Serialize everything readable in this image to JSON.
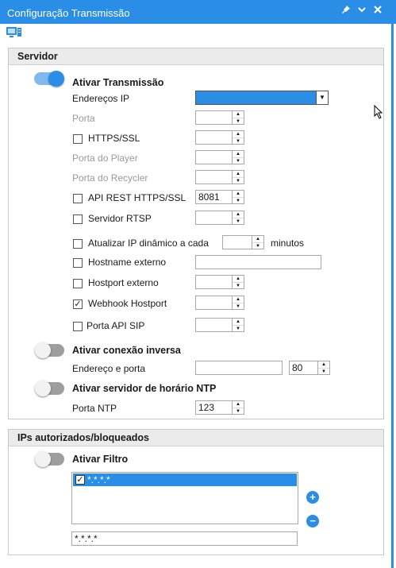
{
  "window": {
    "title": "Configuração Transmissão"
  },
  "servidor": {
    "header": "Servidor",
    "ativar_transmissao": "Ativar Transmissão",
    "enderecos_ip": "Endereços IP",
    "porta": "Porta",
    "https_ssl": "HTTPS/SSL",
    "porta_player": "Porta do Player",
    "porta_recycler": "Porta do Recycler",
    "api_rest": "API REST HTTPS/SSL",
    "api_rest_value": "8081",
    "rtsp": "Servidor RTSP",
    "atualizar_ip": "Atualizar IP dinâmico a cada",
    "minutos": "minutos",
    "hostname": "Hostname externo",
    "hostport": "Hostport externo",
    "webhook": "Webhook Hostport",
    "porta_api_sip": "Porta API SIP",
    "conexao_inversa": "Ativar conexão inversa",
    "endereco_porta": "Endereço e porta",
    "endereco_porta_value": "80",
    "ntp": "Ativar servidor de horário NTP",
    "porta_ntp": "Porta NTP",
    "porta_ntp_value": "123"
  },
  "ips": {
    "header": "IPs autorizados/bloqueados",
    "ativar_filtro": "Ativar Filtro",
    "list_item": "*.*.*.*",
    "input_value": "*.*.*.*"
  },
  "colors": {
    "accent": "#2a8ee6"
  }
}
